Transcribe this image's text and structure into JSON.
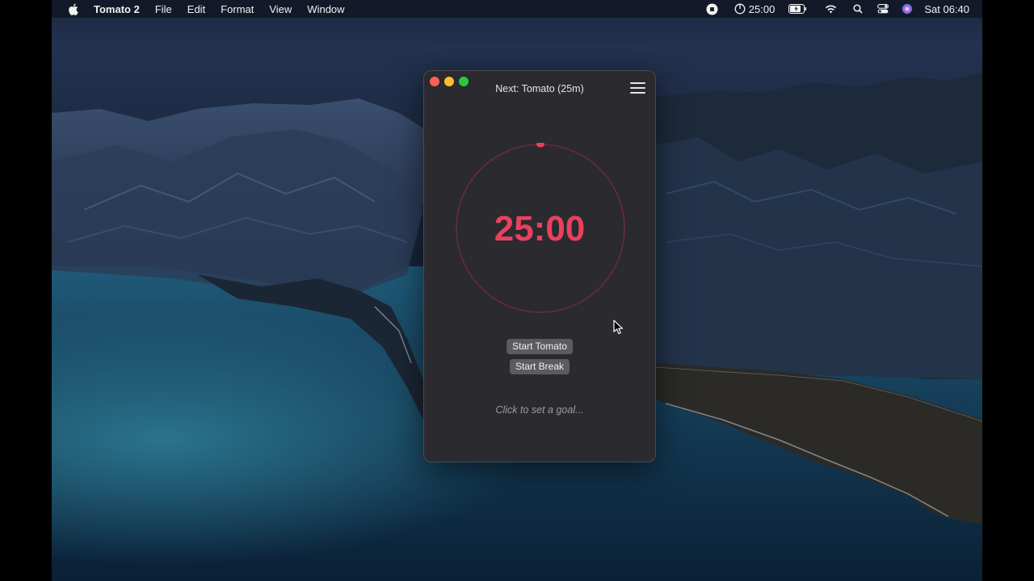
{
  "menubar": {
    "app_name": "Tomato 2",
    "menus": [
      "File",
      "Edit",
      "Format",
      "View",
      "Window"
    ],
    "timer": "25:00",
    "clock": "Sat 06:40"
  },
  "window": {
    "title": "Next: Tomato (25m)",
    "timer": "25:00",
    "start_tomato": "Start Tomato",
    "start_break": "Start Break",
    "goal_placeholder": "Click to set a goal...",
    "progress": 0
  },
  "colors": {
    "accent": "#e8415e",
    "window_bg": "#2a2a2f",
    "button_bg": "#5b5b60"
  }
}
